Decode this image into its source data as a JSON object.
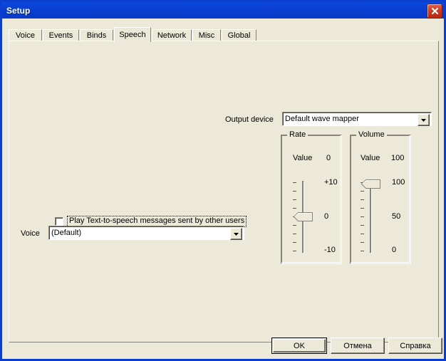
{
  "window": {
    "title": "Setup",
    "close_icon": "close-icon",
    "titlebar_color": "#0A3FD0",
    "face_color": "#ECE9D8"
  },
  "tabs": [
    {
      "label": "Voice",
      "selected": false
    },
    {
      "label": "Events",
      "selected": false
    },
    {
      "label": "Binds",
      "selected": false
    },
    {
      "label": "Speech",
      "selected": true
    },
    {
      "label": "Network",
      "selected": false
    },
    {
      "label": "Misc",
      "selected": false
    },
    {
      "label": "Global",
      "selected": false
    }
  ],
  "speech": {
    "output_device": {
      "label": "Output device",
      "value": "Default wave mapper",
      "dropdown_icon": "chevron-down-icon"
    },
    "play_tts_checkbox": {
      "label": "Play Text-to-speech messages sent by other users",
      "checked": false
    },
    "voice": {
      "label": "Voice",
      "value": "(Default)",
      "dropdown_icon": "chevron-down-icon"
    },
    "rate": {
      "group_title": "Rate",
      "value_label": "Value",
      "value": "0",
      "scale_top": "+10",
      "scale_mid": "0",
      "scale_bottom": "-10",
      "tick_count": 9,
      "thumb_position_percent": 50
    },
    "volume": {
      "group_title": "Volume",
      "value_label": "Value",
      "value": "100",
      "scale_top": "100",
      "scale_mid": "50",
      "scale_bottom": "0",
      "tick_count": 9,
      "thumb_position_percent": 0
    }
  },
  "buttons": {
    "ok": "OK",
    "cancel": "Отмена",
    "help": "Справка"
  }
}
